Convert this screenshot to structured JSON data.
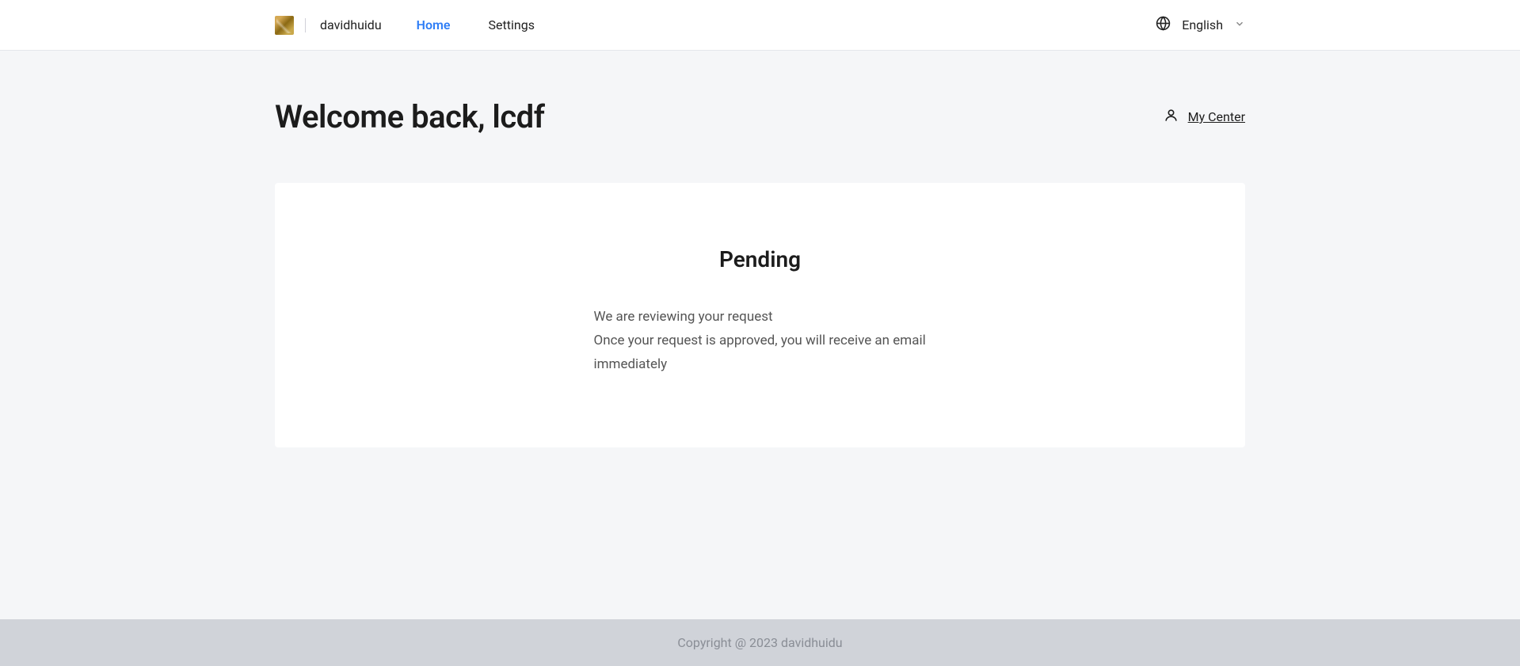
{
  "header": {
    "brand": "davidhuidu",
    "nav": {
      "home": "Home",
      "settings": "Settings"
    },
    "language": "English"
  },
  "main": {
    "welcome": "Welcome back, lcdf",
    "my_center": "My Center",
    "pending": {
      "title": "Pending",
      "line1": "We are reviewing your request",
      "line2": "Once your request is approved, you will receive an email immediately"
    }
  },
  "footer": {
    "copyright": "Copyright @ 2023 davidhuidu"
  }
}
